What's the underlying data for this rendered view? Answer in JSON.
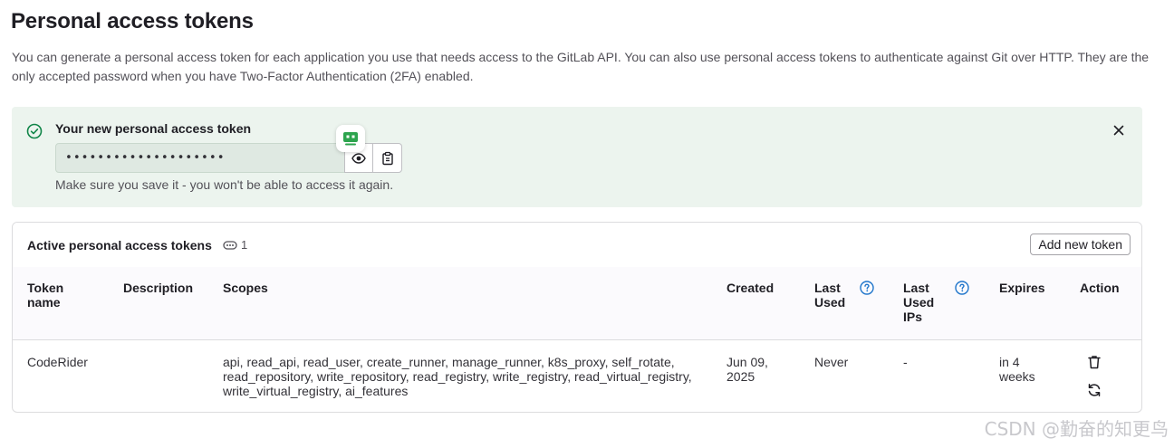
{
  "page": {
    "title": "Personal access tokens",
    "intro": "You can generate a personal access token for each application you use that needs access to the GitLab API. You can also use personal access tokens to authenticate against Git over HTTP. They are the only accepted password when you have Two-Factor Authentication (2FA) enabled."
  },
  "alert": {
    "title": "Your new personal access token",
    "token_value": "••••••••••••••••••••",
    "note": "Make sure you save it - you won't be able to access it again.",
    "icons": {
      "status": "check-circle-icon",
      "reveal": "eye-icon",
      "copy": "clipboard-icon",
      "close": "close-icon",
      "extension": "extension-robot-icon"
    }
  },
  "tokens_card": {
    "title": "Active personal access tokens",
    "count": "1",
    "add_button": "Add new token",
    "columns": {
      "name": "Token name",
      "description": "Description",
      "scopes": "Scopes",
      "created": "Created",
      "last_used": "Last Used",
      "last_used_ips": "Last Used IPs",
      "expires": "Expires",
      "action": "Action"
    },
    "rows": [
      {
        "name": "CodeRider",
        "description": "",
        "scopes": "api, read_api, read_user, create_runner, manage_runner, k8s_proxy, self_rotate, read_repository, write_repository, read_registry, write_registry, read_virtual_registry, write_virtual_registry, ai_features",
        "created": "Jun 09, 2025",
        "last_used": "Never",
        "last_used_ips": "-",
        "expires": "in 4 weeks"
      }
    ]
  },
  "watermark": "CSDN @勤奋的知更鸟",
  "colors": {
    "success_bg": "#ecf4ee",
    "success_icon": "#108548",
    "help_icon": "#1f75cb",
    "text": "#1f1e24"
  }
}
